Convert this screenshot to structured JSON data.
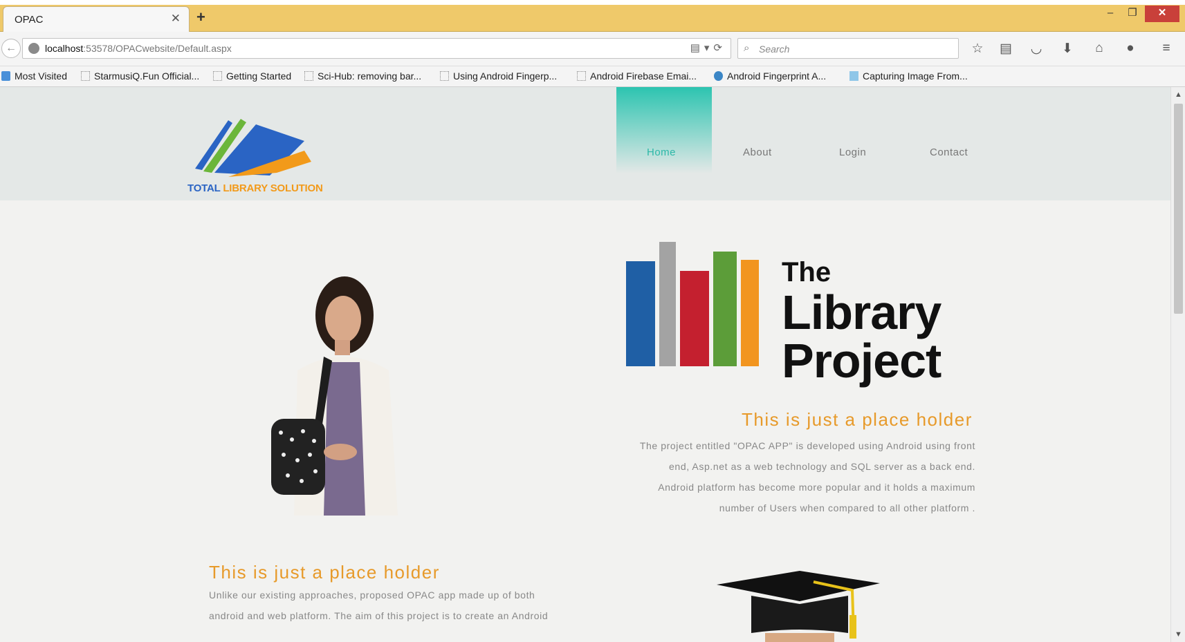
{
  "browser": {
    "tab_title": "OPAC",
    "url_host": "localhost",
    "url_rest": ":53578/OPACwebsite/Default.aspx",
    "search_placeholder": "Search",
    "bookmarks": [
      "Most Visited",
      "StarmusiQ.Fun Official...",
      "Getting Started",
      "Sci-Hub: removing bar...",
      "Using Android Fingerp...",
      "Android Firebase Emai...",
      "Android Fingerprint A...",
      "Capturing Image From..."
    ]
  },
  "site": {
    "logo_word_1": "TOTAL",
    "logo_word_2": "LIBRARY",
    "logo_word_3": "SOLUTION",
    "nav": [
      "Home",
      "About",
      "Login",
      "Contact"
    ],
    "hero_logo": {
      "line1": "The",
      "line2": "Library",
      "line3": "Project"
    },
    "section1": {
      "heading": "This is just a place holder",
      "lines": [
        "The project entitled \"OPAC APP\" is developed using Android using front",
        "end, Asp.net as a web technology and SQL server as a back end.",
        "Android platform has become more popular and it holds a maximum",
        "number of Users when compared to all other platform ."
      ]
    },
    "section2": {
      "heading": "This is just a place holder",
      "lines": [
        "Unlike our existing approaches, proposed OPAC app made up of both",
        "android and web platform. The aim of this project is to create an Android"
      ]
    }
  },
  "colors": {
    "tabstrip": "#efc96a",
    "accent_orange": "#e79a2a",
    "nav_active": "#2db8a8"
  }
}
